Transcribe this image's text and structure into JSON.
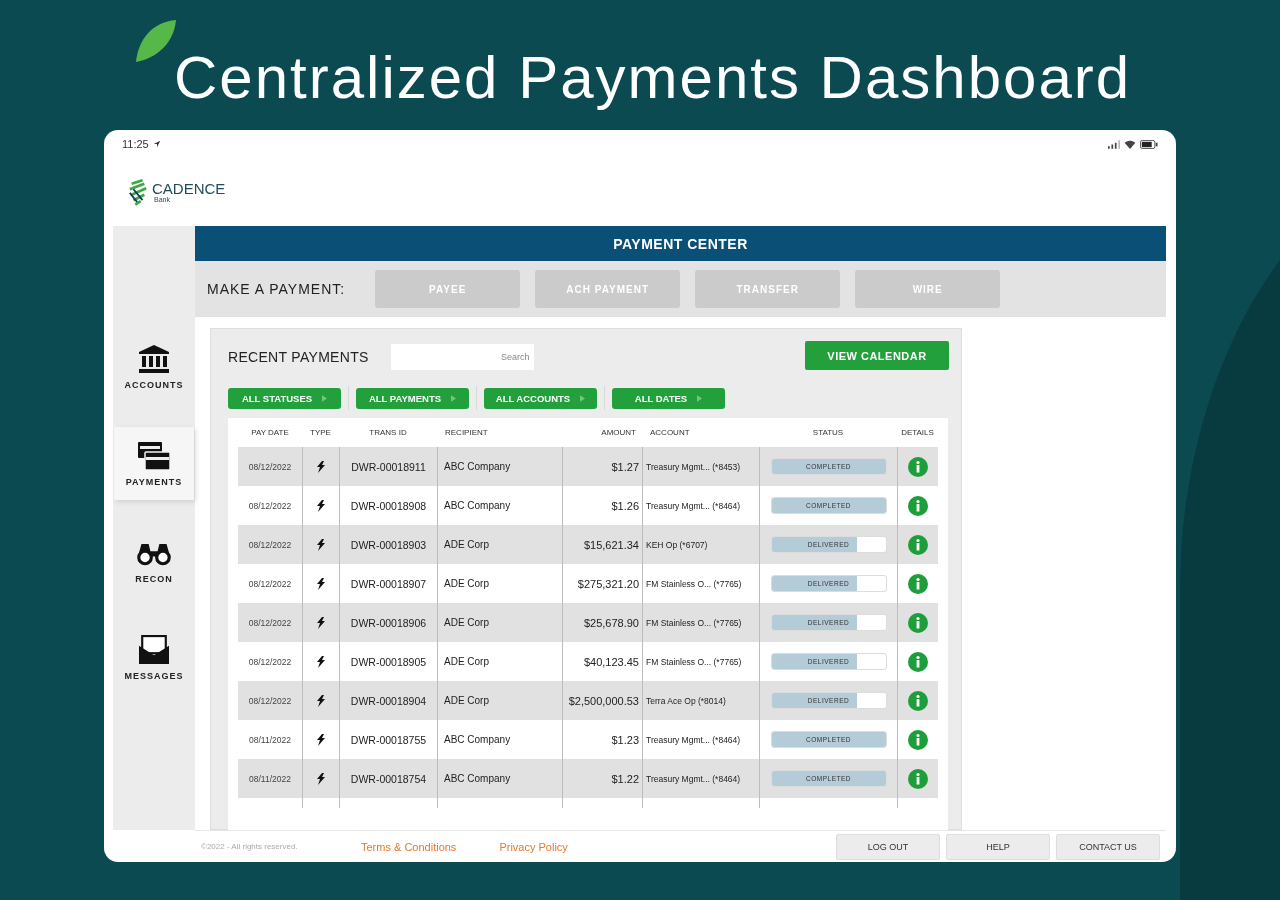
{
  "headline": "Centralized Payments Dashboard",
  "status_bar": {
    "time": "11:25"
  },
  "brand": {
    "name": "CADENCE",
    "sub": "Bank"
  },
  "sidebar": {
    "items": [
      {
        "label": "ACCOUNTS",
        "kind": "bank",
        "selected": false
      },
      {
        "label": "PAYMENTS",
        "kind": "card",
        "selected": true
      },
      {
        "label": "RECON",
        "kind": "binoculars",
        "selected": false
      },
      {
        "label": "MESSAGES",
        "kind": "envelope",
        "selected": false
      }
    ]
  },
  "header": {
    "title": "PAYMENT CENTER"
  },
  "make_payment": {
    "label": "MAKE A PAYMENT:",
    "buttons": [
      "PAYEE",
      "ACH PAYMENT",
      "TRANSFER",
      "WIRE"
    ]
  },
  "recent": {
    "title": "RECENT PAYMENTS",
    "search": {
      "placeholder": "Search"
    },
    "calendar_button": "VIEW CALENDAR",
    "filters": [
      "ALL STATUSES",
      "ALL PAYMENTS",
      "ALL ACCOUNTS",
      "ALL DATES"
    ]
  },
  "table": {
    "columns": [
      "PAY DATE",
      "TYPE",
      "TRANS ID",
      "RECIPIENT",
      "AMOUNT",
      "ACCOUNT",
      "STATUS",
      "DETAILS"
    ],
    "rows": [
      {
        "date": "08/12/2022",
        "trans_id": "DWR-00018911",
        "recipient": "ABC Company",
        "amount": "$1.27",
        "account": "Treasury Mgmt... (*8453)",
        "status": "COMPLETED",
        "level": 1
      },
      {
        "date": "08/12/2022",
        "trans_id": "DWR-00018908",
        "recipient": "ABC Company",
        "amount": "$1.26",
        "account": "Treasury Mgmt... (*8464)",
        "status": "COMPLETED",
        "level": 1
      },
      {
        "date": "08/12/2022",
        "trans_id": "DWR-00018903",
        "recipient": "ADE Corp",
        "amount": "$15,621.34",
        "account": "KEH Op (*6707)",
        "status": "DELIVERED",
        "level": 0.75
      },
      {
        "date": "08/12/2022",
        "trans_id": "DWR-00018907",
        "recipient": "ADE Corp",
        "amount": "$275,321.20",
        "account": "FM Stainless O... (*7765)",
        "status": "DELIVERED",
        "level": 0.75
      },
      {
        "date": "08/12/2022",
        "trans_id": "DWR-00018906",
        "recipient": "ADE Corp",
        "amount": "$25,678.90",
        "account": "FM Stainless O... (*7765)",
        "status": "DELIVERED",
        "level": 0.75
      },
      {
        "date": "08/12/2022",
        "trans_id": "DWR-00018905",
        "recipient": "ADE Corp",
        "amount": "$40,123.45",
        "account": "FM Stainless O... (*7765)",
        "status": "DELIVERED",
        "level": 0.75
      },
      {
        "date": "08/12/2022",
        "trans_id": "DWR-00018904",
        "recipient": "ADE Corp",
        "amount": "$2,500,000.53",
        "account": "Terra Ace Op (*8014)",
        "status": "DELIVERED",
        "level": 0.75
      },
      {
        "date": "08/11/2022",
        "trans_id": "DWR-00018755",
        "recipient": "ABC Company",
        "amount": "$1.23",
        "account": "Treasury Mgmt... (*8464)",
        "status": "COMPLETED",
        "level": 1
      },
      {
        "date": "08/11/2022",
        "trans_id": "DWR-00018754",
        "recipient": "ABC Company",
        "amount": "$1.22",
        "account": "Treasury Mgmt... (*8464)",
        "status": "COMPLETED",
        "level": 1
      }
    ]
  },
  "footer": {
    "copyright": "©2022 - All rights reserved.",
    "links": [
      "Terms & Conditions",
      "Privacy Policy"
    ],
    "buttons": [
      "LOG OUT",
      "HELP",
      "CONTACT US"
    ]
  }
}
